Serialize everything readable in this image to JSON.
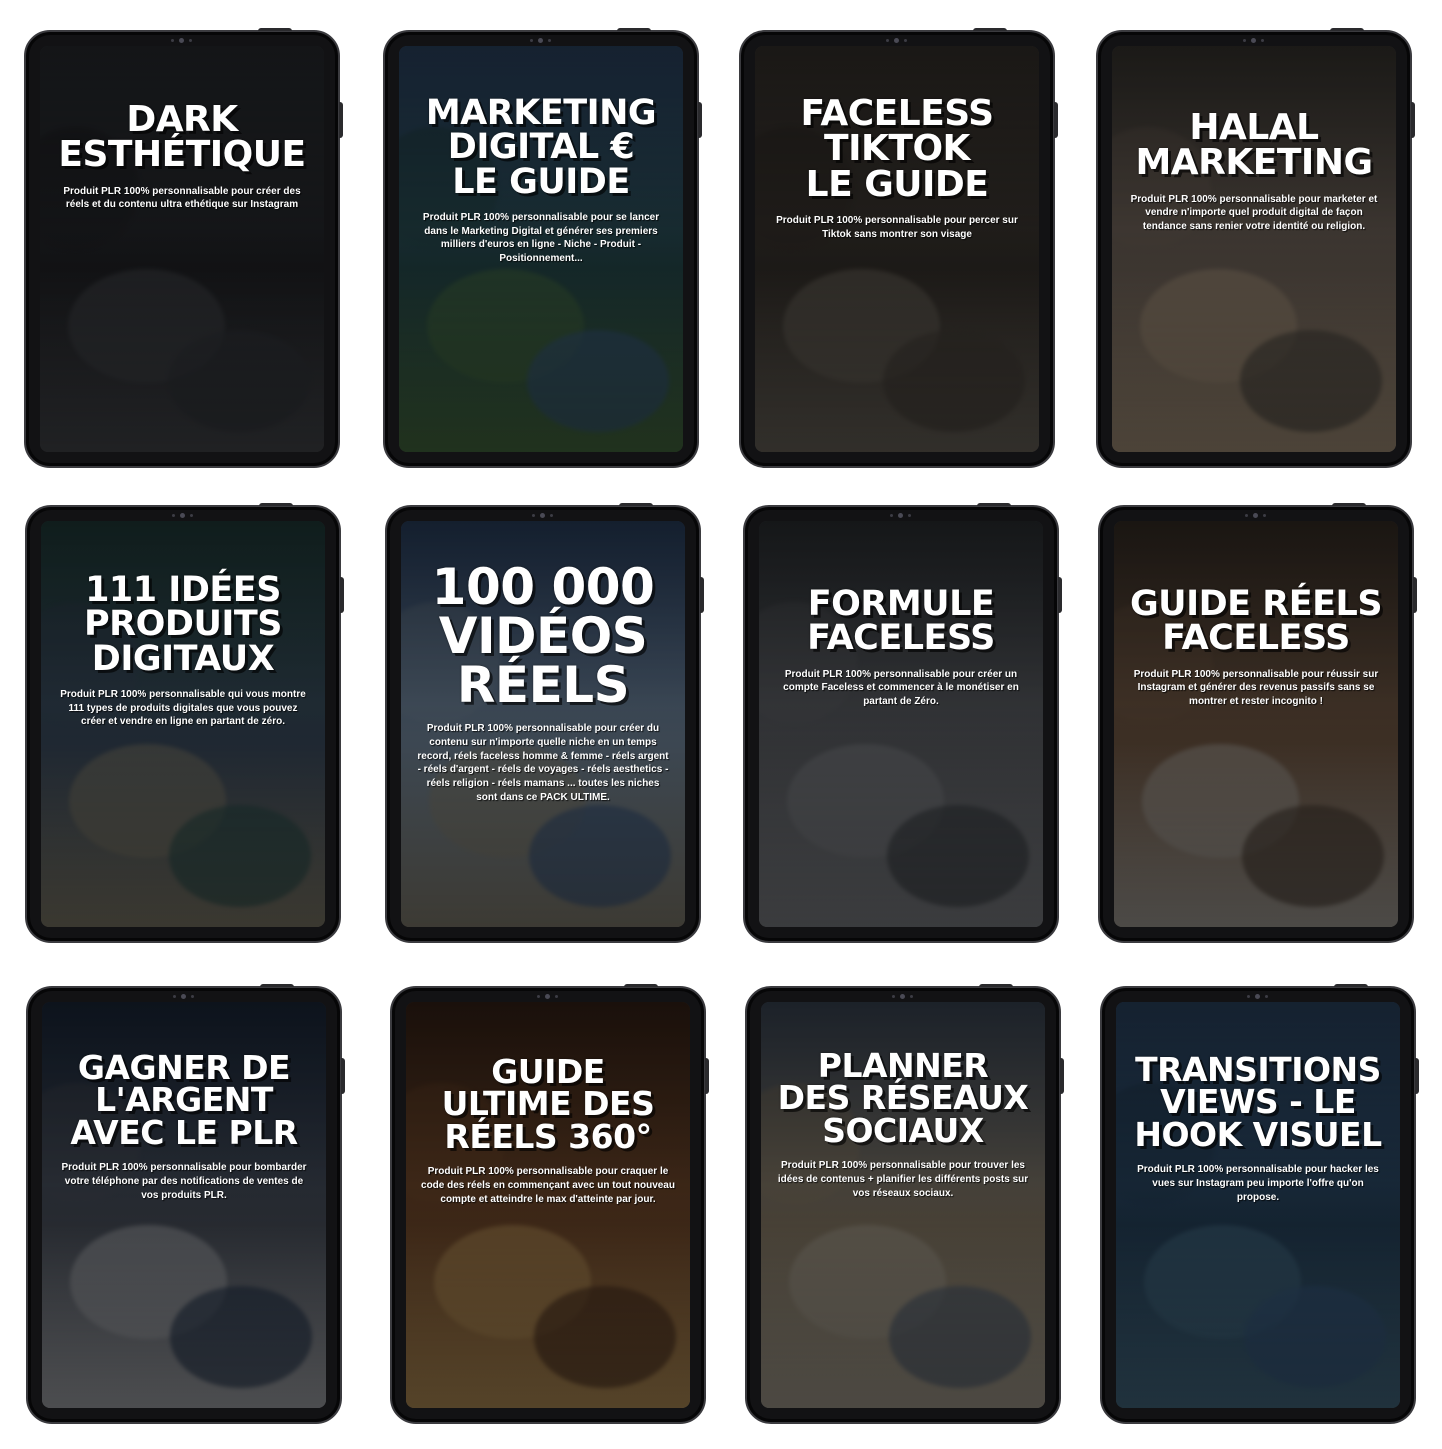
{
  "products": [
    {
      "title_lines": [
        "DARK",
        "ESTHÉTIQUE"
      ],
      "description": "Produit PLR 100% personnalisable pour créer des réels et du contenu ultra ethétique sur Instagram",
      "photo_colors": [
        "#2b2e33",
        "#1a1b1e",
        "#3a3c40"
      ]
    },
    {
      "title_lines": [
        "MARKETING",
        "DIGITAL €",
        "LE GUIDE"
      ],
      "description": "Produit PLR 100% personnalisable pour se lancer dans le Marketing Digital et générer ses premiers milliers d'euros en ligne - Niche - Produit - Positionnement...",
      "photo_colors": [
        "#2f4a6b",
        "#1e3a3c",
        "#3b5a36"
      ]
    },
    {
      "title_lines": [
        "FACELESS",
        "TIKTOK",
        "LE GUIDE"
      ],
      "description": "Produit PLR 100% personnalisable pour percer sur Tiktok sans montrer son visage",
      "photo_colors": [
        "#3a3530",
        "#2a2622",
        "#5a554d"
      ]
    },
    {
      "title_lines": [
        "HALAL",
        "MARKETING"
      ],
      "description": "Produit PLR 100% personnalisable pour marketer et vendre n'importe quel produit digital de façon tendance sans renier votre identité ou religion.",
      "photo_colors": [
        "#3b3833",
        "#5a5048",
        "#8a7a66"
      ]
    },
    {
      "title_lines": [
        "111 IDÉES",
        "PRODUITS",
        "DIGITAUX"
      ],
      "description": "Produit PLR 100% personnalisable qui vous montre 111 types de produits digitales que vous pouvez créer et vendre en ligne en partant de zéro.",
      "photo_colors": [
        "#22403e",
        "#2e3b4a",
        "#6a6658"
      ]
    },
    {
      "title_lines": [
        "100 000",
        "VIDÉOS",
        "RÉELS"
      ],
      "description": "Produit PLR 100% personnalisable pour créer du contenu sur n'importe quelle niche en un temps record, réels faceless homme & femme - réels argent - réels d'argent - réels de voyages - réels aesthetics - réels religion - réels mamans ... toutes les niches sont dans ce PACK ULTIME.",
      "photo_colors": [
        "#2c4466",
        "#5a6a7a",
        "#6e6a5e"
      ]
    },
    {
      "title_lines": [
        "FORMULE",
        "FACELESS"
      ],
      "description": "Produit PLR 100% personnalisable pour créer un compte Faceless et commencer à le monétiser en partant de Zéro.",
      "photo_colors": [
        "#2e3236",
        "#4a4c50",
        "#6a6c70"
      ]
    },
    {
      "title_lines": [
        "GUIDE RÉELS",
        "FACELESS"
      ],
      "description": "Produit PLR 100% personnalisable pour réussir sur Instagram et générer des revenus passifs sans se montrer et rester incognito !",
      "photo_colors": [
        "#3a3028",
        "#5a4636",
        "#8a8680"
      ]
    },
    {
      "title_lines": [
        "GAGNER DE",
        "L'ARGENT",
        "AVEC LE PLR"
      ],
      "description": "Produit PLR 100% personnalisable pour bombarder votre téléphone par des notifications de ventes de vos produits PLR.",
      "photo_colors": [
        "#1c2a3e",
        "#3a3f48",
        "#8a8c90"
      ]
    },
    {
      "title_lines": [
        "GUIDE",
        "ULTIME DES",
        "RÉELS 360°"
      ],
      "description": "Produit PLR 100% personnalisable pour craquer le code des réels en commençant avec un tout nouveau compte et atteindre le max d'atteinte par jour.",
      "photo_colors": [
        "#3a2418",
        "#5a3a22",
        "#9a7a4a"
      ]
    },
    {
      "title_lines": [
        "PLANNER",
        "DES RÉSEAUX",
        "SOCIAUX"
      ],
      "description": "Produit PLR 100% personnalisable pour trouver les idées de contenus + planifier les différents posts sur vos réseaux sociaux.",
      "photo_colors": [
        "#3e4a5a",
        "#6a6050",
        "#8a8478"
      ]
    },
    {
      "title_lines": [
        "TRANSITIONS",
        "VIEWS - LE",
        "HOOK VISUEL"
      ],
      "description": "Produit PLR 100% personnalisable pour hacker les vues sur Instagram peu importe l'offre qu'on propose.",
      "photo_colors": [
        "#2e4a6a",
        "#1e3448",
        "#3a5a6e"
      ]
    }
  ]
}
